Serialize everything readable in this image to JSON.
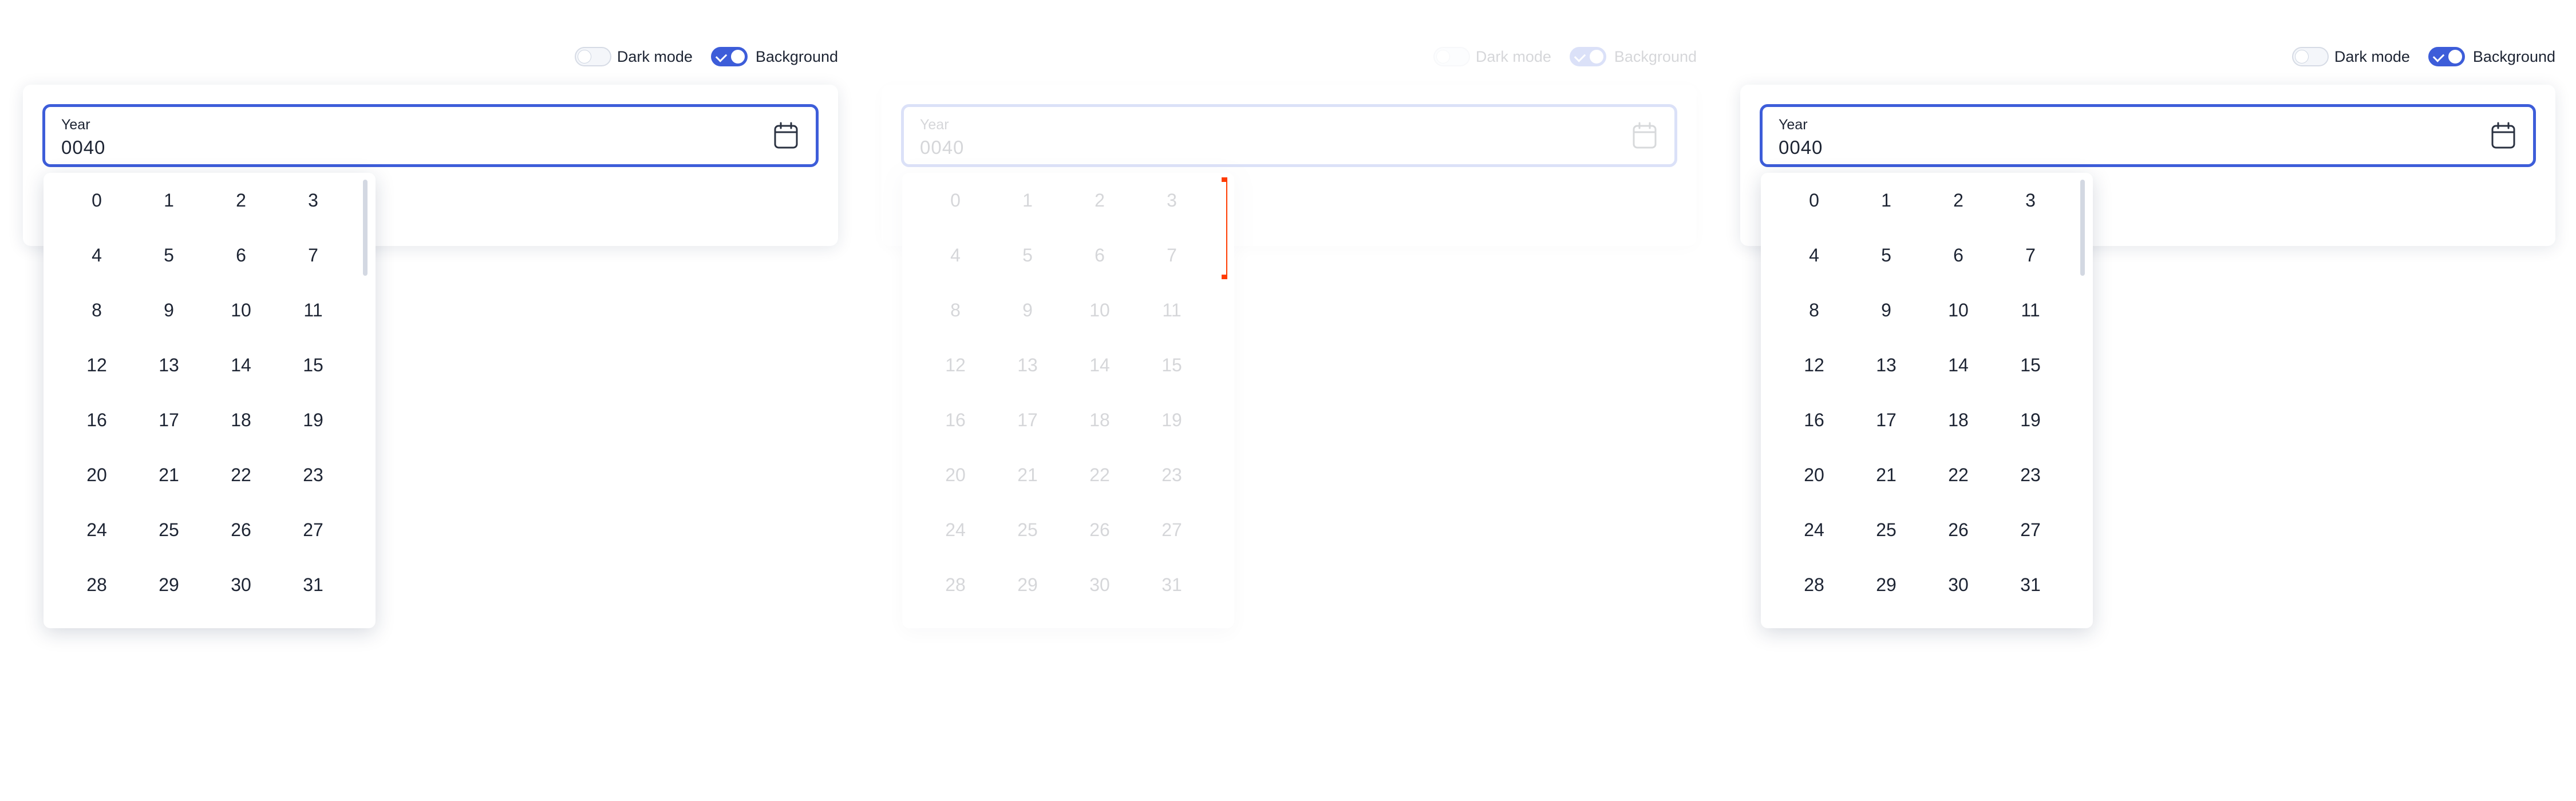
{
  "dark_mode_label": "Dark mode",
  "background_label": "Background",
  "year_label": "Year",
  "year_value": "0040",
  "days": [
    "0",
    "1",
    "2",
    "3",
    "4",
    "5",
    "6",
    "7",
    "8",
    "9",
    "10",
    "11",
    "12",
    "13",
    "14",
    "15",
    "16",
    "17",
    "18",
    "19",
    "20",
    "21",
    "22",
    "23",
    "24",
    "25",
    "26",
    "27",
    "28",
    "29",
    "30",
    "31"
  ],
  "toggles": {
    "dark_mode": false,
    "background": true
  },
  "colors": {
    "accent": "#3d5dd9",
    "text": "#1d2433",
    "marker": "#ff3b00"
  },
  "icons": {
    "calendar": "calendar-icon",
    "check": "check-icon"
  }
}
